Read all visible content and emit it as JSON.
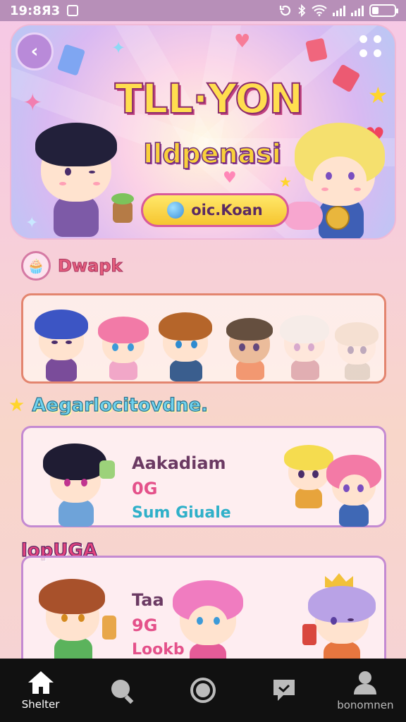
{
  "status_bar": {
    "time": "19:8Я3"
  },
  "banner": {
    "title": "TLL·YON",
    "subtitle": "Ildpenasi",
    "button_label": "oic.Koan"
  },
  "section1": {
    "title": "Dwapk"
  },
  "section2": {
    "title": "Aegarlocitovdne."
  },
  "card2": {
    "title": "Aakadiam",
    "number": "0G",
    "subtitle": "Sum Giuale"
  },
  "section3": {
    "title": "lopUGA"
  },
  "card3": {
    "title": "Taa",
    "number": "9G",
    "subtitle": "Lookb"
  },
  "nav": [
    {
      "label": "Shelter",
      "icon": "home-icon"
    },
    {
      "label": "",
      "icon": "search-icon"
    },
    {
      "label": "",
      "icon": "record-icon"
    },
    {
      "label": "",
      "icon": "chat-icon"
    },
    {
      "label": "bonomnen",
      "icon": "profile-icon"
    }
  ],
  "colors": {
    "accent": "#e4518a",
    "banner_button": "#f6c52f",
    "nav_bg": "#111111"
  }
}
